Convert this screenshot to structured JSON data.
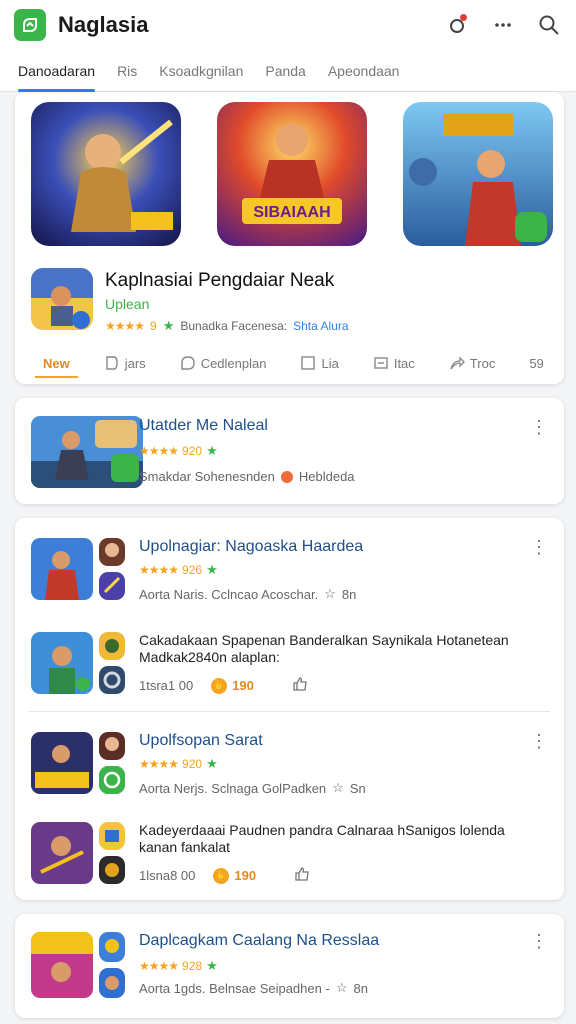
{
  "app": {
    "title": "Naglasia"
  },
  "tabs": [
    {
      "label": "Danoadaran"
    },
    {
      "label": "Ris"
    },
    {
      "label": "Ksoadkgnilan"
    },
    {
      "label": "Panda"
    },
    {
      "label": "Apeondaan"
    }
  ],
  "featured": {
    "title": "Kaplnasiai Pengdaiar Neak",
    "subtitle": "Uplean",
    "rating": "9",
    "meta": "Bunadka Facenesa:",
    "link": "Shta Alura",
    "banner_badge": "SIBAIAAH"
  },
  "actions": [
    {
      "label": "New"
    },
    {
      "label": "jars"
    },
    {
      "label": "Cedlenplan"
    },
    {
      "label": "Lia"
    },
    {
      "label": "Itac"
    },
    {
      "label": "Troc"
    },
    {
      "label": "59"
    }
  ],
  "items": [
    {
      "title": "Utatder Me Naleal",
      "rating": "920",
      "meta": "Smakdar Sohenesnden",
      "meta2": "Hebldeda"
    },
    {
      "title": "Upolnagiar: Nagoaska Haardea",
      "rating": "926",
      "meta": "Aorta Naris. Cclncao Acoschar.",
      "meta_count": "8n",
      "sub_text": "Cakadakaan Spapenan Banderalkan Saynikala Hotanetean Madkak2840n alaplan:",
      "likes": "1tsra1 00",
      "coins": "190"
    },
    {
      "title": "Upolfsopan Sarat",
      "rating": "920",
      "meta": "Aorta Nerjs. Sclnaga GolPadken",
      "meta_count": "Sn",
      "sub_text": "Kadeyerdaaai Paudnen pandra Calnaraa hSanigos lolenda kanan fankalat",
      "likes": "1lsna8 00",
      "coins": "190"
    },
    {
      "title": "Daplcagkam Caalang Na Resslaa",
      "rating": "928",
      "meta": "Aorta 1gds. Belnsae Seipadhen -",
      "meta_count": "8n"
    }
  ],
  "colors": {
    "accent": "#2f80ed",
    "brand": "#3bb54a",
    "star": "#f4a422"
  }
}
